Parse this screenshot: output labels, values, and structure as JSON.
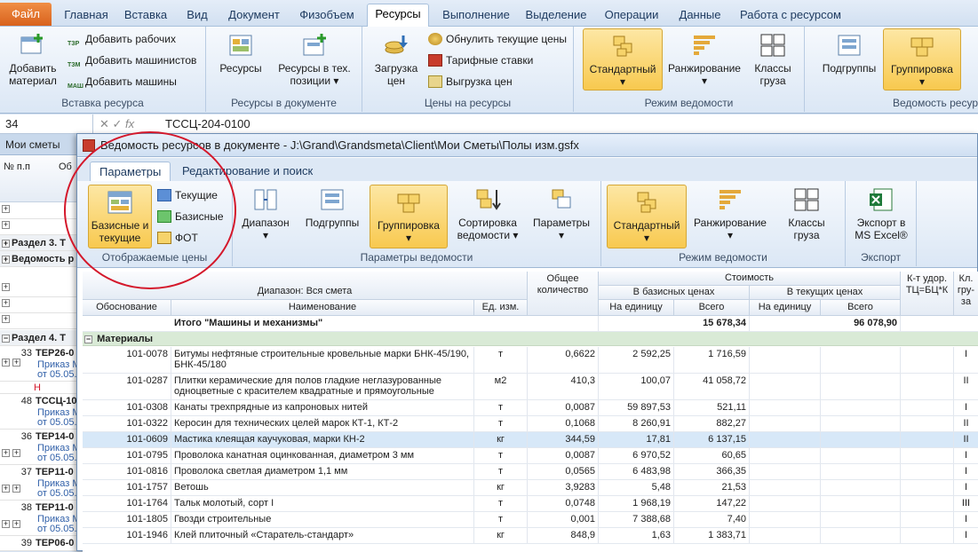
{
  "main_tabs": [
    "Файл",
    "Главная",
    "Вставка",
    "Вид",
    "Документ",
    "Физобъем",
    "Ресурсы",
    "Выполнение",
    "Выделение",
    "Операции",
    "Данные",
    "Работа с ресурсом"
  ],
  "ribbon": {
    "add_material": "Добавить материал",
    "add_workers": "Добавить рабочих",
    "add_machinists": "Добавить машинистов",
    "add_machines": "Добавить машины",
    "grp_insert": "Вставка ресурса",
    "resources": "Ресурсы",
    "resources_tech": "Ресурсы в тех. позиции",
    "grp_doc": "Ресурсы в документе",
    "load_prices": "Загрузка цен",
    "reset_prices": "Обнулить текущие цены",
    "tariff_rates": "Тарифные ставки",
    "export_prices": "Выгрузка цен",
    "grp_prices": "Цены на ресурсы",
    "standard": "Стандартный",
    "ranking": "Ранжирование",
    "cargo_classes": "Классы груза",
    "grp_mode": "Режим ведомости",
    "subgroups": "Подгруппы",
    "grouping": "Группировка",
    "grp_mode2": "Ведомость ресур",
    "letters_t3p": "ТЗР",
    "letters_t3m": "ТЗМ",
    "letters_mash": "МАШ"
  },
  "formula": {
    "cell": "34",
    "value": "ТССЦ-204-0100"
  },
  "left": {
    "tab": "Мои сметы",
    "col_no": "№ п.п",
    "col_ob": "Об",
    "section3": "Раздел 3. Т",
    "vedomost": "Ведомость р",
    "section4": "Раздел 4. Т",
    "rows": [
      {
        "n": "33",
        "code": "ТЕР26-0",
        "sub": "Приказ М",
        "date": "от 05.05."
      },
      {
        "n": "",
        "code": "",
        "sub": "Н",
        "date": ""
      },
      {
        "n": "48",
        "code": "ТССЦ-10",
        "sub": "Приказ М",
        "date": "от 05.05."
      },
      {
        "n": "36",
        "code": "ТЕР14-0",
        "sub": "Приказ М",
        "date": "от 05.05."
      },
      {
        "n": "37",
        "code": "ТЕР11-0",
        "sub": "Приказ М",
        "date": "от 05.05."
      },
      {
        "n": "38",
        "code": "ТЕР11-0",
        "sub": "Приказ М",
        "date": "от 05.05."
      },
      {
        "n": "39",
        "code": "ТЕР06-0",
        "sub": "Приказ М",
        "date": "от 05.05."
      }
    ]
  },
  "window": {
    "title": "Ведомость ресурсов в документе - J:\\Grand\\Grandsmeta\\Client\\Мои Сметы\\Полы изм.gsfx",
    "tabs": [
      "Параметры",
      "Редактирование и поиск"
    ],
    "basic_current": "Базисные и текущие",
    "current": "Текущие",
    "basic": "Базисные",
    "fot": "ФОТ",
    "grp_shown": "Отображаемые цены",
    "range": "Диапазон",
    "subgroups": "Подгруппы",
    "grouping": "Группировка",
    "sort": "Сортировка ведомости",
    "params": "Параметры",
    "grp_params": "Параметры ведомости",
    "standard": "Стандартный",
    "ranking": "Ранжирование",
    "cargo": "Классы груза",
    "grp_mode": "Режим ведомости",
    "excel": "Экспорт в MS Excel®",
    "grp_export": "Экспорт"
  },
  "grid": {
    "range_label": "Диапазон: Вся смета",
    "total_qty": "Общее количество",
    "cost": "Стоимость",
    "in_basic": "В базисных ценах",
    "in_current": "В текущих ценах",
    "coef": "К-т удор. ТЦ=БЦ*К",
    "cargo_class": "Кл. гру-за",
    "col_basis": "Обоснование",
    "col_name": "Наименование",
    "col_unit": "Ед. изм.",
    "per_unit": "На единицу",
    "total": "Всего",
    "per_unit2": "На единицу",
    "total2": "Всего",
    "sum_label": "Итого \"Машины и механизмы\"",
    "sum_basic": "15 678,34",
    "sum_current": "96 078,90",
    "section": "Материалы",
    "rows": [
      {
        "code": "101-0078",
        "name": "Битумы нефтяные строительные кровельные марки БНК-45/190, БНК-45/180",
        "unit": "т",
        "qty": "0,6622",
        "pu": "2 592,25",
        "tot": "1 716,59",
        "cls": "I"
      },
      {
        "code": "101-0287",
        "name": "Плитки керамические для полов гладкие неглазурованные одноцветные с красителем квадратные и прямоугольные",
        "unit": "м2",
        "qty": "410,3",
        "pu": "100,07",
        "tot": "41 058,72",
        "cls": "II"
      },
      {
        "code": "101-0308",
        "name": "Канаты трехпрядные из капроновых нитей",
        "unit": "т",
        "qty": "0,0087",
        "pu": "59 897,53",
        "tot": "521,11",
        "cls": "I"
      },
      {
        "code": "101-0322",
        "name": "Керосин для технических целей марок КТ-1, КТ-2",
        "unit": "т",
        "qty": "0,1068",
        "pu": "8 260,91",
        "tot": "882,27",
        "cls": "II"
      },
      {
        "code": "101-0609",
        "name": "Мастика клеящая каучуковая, марки КН-2",
        "unit": "кг",
        "qty": "344,59",
        "pu": "17,81",
        "tot": "6 137,15",
        "cls": "II"
      },
      {
        "code": "101-0795",
        "name": "Проволока канатная оцинкованная, диаметром 3 мм",
        "unit": "т",
        "qty": "0,0087",
        "pu": "6 970,52",
        "tot": "60,65",
        "cls": "I"
      },
      {
        "code": "101-0816",
        "name": "Проволока светлая диаметром 1,1 мм",
        "unit": "т",
        "qty": "0,0565",
        "pu": "6 483,98",
        "tot": "366,35",
        "cls": "I"
      },
      {
        "code": "101-1757",
        "name": "Ветошь",
        "unit": "кг",
        "qty": "3,9283",
        "pu": "5,48",
        "tot": "21,53",
        "cls": "I"
      },
      {
        "code": "101-1764",
        "name": "Тальк молотый, сорт I",
        "unit": "т",
        "qty": "0,0748",
        "pu": "1 968,19",
        "tot": "147,22",
        "cls": "III"
      },
      {
        "code": "101-1805",
        "name": "Гвозди строительные",
        "unit": "т",
        "qty": "0,001",
        "pu": "7 388,68",
        "tot": "7,40",
        "cls": "I"
      },
      {
        "code": "101-1946",
        "name": "Клей плиточный «Старатель-стандарт»",
        "unit": "кг",
        "qty": "848,9",
        "pu": "1,63",
        "tot": "1 383,71",
        "cls": "I"
      }
    ]
  },
  "colors": {
    "accent": "#f8c94f",
    "selection": "#d7e8f8",
    "section": "#d9ead6",
    "circle": "#d4182b"
  }
}
